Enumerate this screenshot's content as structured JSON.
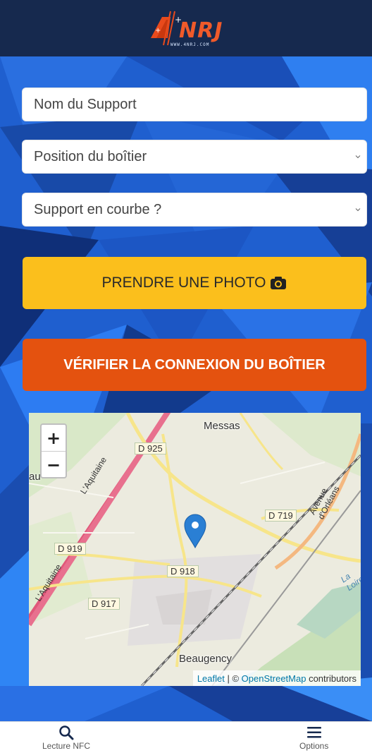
{
  "header": {
    "logo_text": "NRJ",
    "logo_url": "WWW.4NRJ.COM"
  },
  "form": {
    "support_name": {
      "placeholder": "Nom du Support"
    },
    "position": {
      "value": "Position du boîtier"
    },
    "curve": {
      "value": "Support en courbe ?"
    }
  },
  "buttons": {
    "photo_label": "PRENDRE UNE PHOTO",
    "verify_label": "VÉRIFIER LA CONNEXION DU BOÎTIER"
  },
  "map": {
    "zoom_in": "+",
    "zoom_out": "−",
    "places": {
      "messas": "Messas",
      "beaugency": "Beaugency",
      "aquitaine_1": "L'Aquitaine",
      "aquitaine_2": "L'Aquitaine",
      "avenue": "Avenue d'Orléans",
      "loire": "La Loire",
      "au": "au"
    },
    "roads": {
      "d925": "D 925",
      "d719": "D 719",
      "d919": "D 919",
      "d918": "D 918",
      "d917": "D 917"
    },
    "attribution": {
      "leaflet": "Leaflet",
      "sep": " | © ",
      "osm": "OpenStreetMap",
      "contrib": " contributors"
    }
  },
  "tabs": [
    {
      "label": "Lecture NFC",
      "icon": "search-icon"
    },
    {
      "label": "Options",
      "icon": "menu-icon"
    }
  ],
  "colors": {
    "header": "#16294e",
    "photo_button": "#fbbf1c",
    "verify_button": "#e4520f",
    "background": "#1f5fcf"
  }
}
